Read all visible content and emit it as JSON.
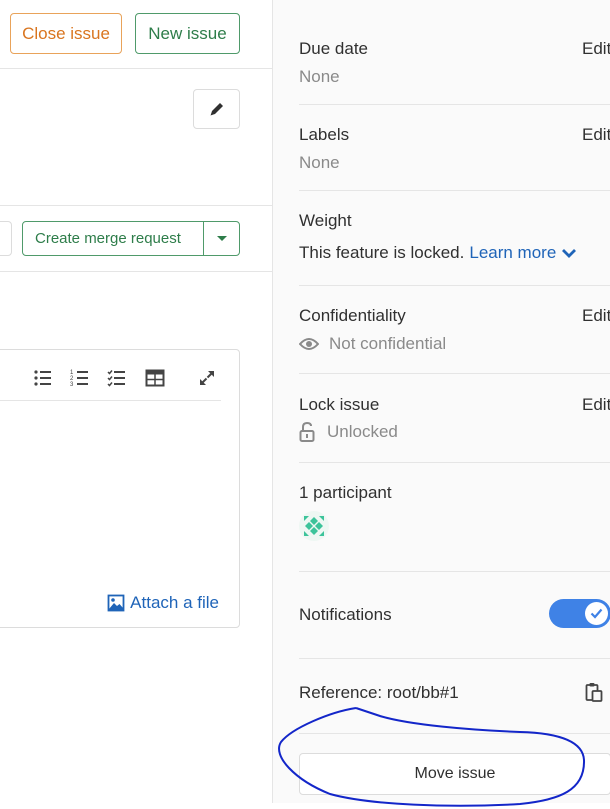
{
  "header": {
    "close_issue": "Close issue",
    "new_issue": "New issue"
  },
  "merge_request": {
    "label": "Create merge request"
  },
  "editor": {
    "attach_label": "Attach a file"
  },
  "sidebar": {
    "due_date": {
      "label": "Due date",
      "value": "None",
      "edit": "Edit"
    },
    "labels": {
      "label": "Labels",
      "value": "None",
      "edit": "Edit"
    },
    "weight": {
      "label": "Weight",
      "locked_text": "This feature is locked.",
      "learn_more": "Learn more"
    },
    "confidentiality": {
      "label": "Confidentiality",
      "value": "Not confidential",
      "edit": "Edit"
    },
    "lock_issue": {
      "label": "Lock issue",
      "value": "Unlocked",
      "edit": "Edit"
    },
    "participants": {
      "label": "1 participant"
    },
    "notifications": {
      "label": "Notifications",
      "enabled": true
    },
    "reference": {
      "label": "Reference: root/bb#1"
    },
    "move_issue": "Move issue"
  },
  "colors": {
    "close_issue_border": "#e9a35a",
    "new_issue_border": "#4f9a6a",
    "link": "#1f64b8",
    "toggle_on": "#3f82e6",
    "annotation_ink": "#1326c9"
  }
}
